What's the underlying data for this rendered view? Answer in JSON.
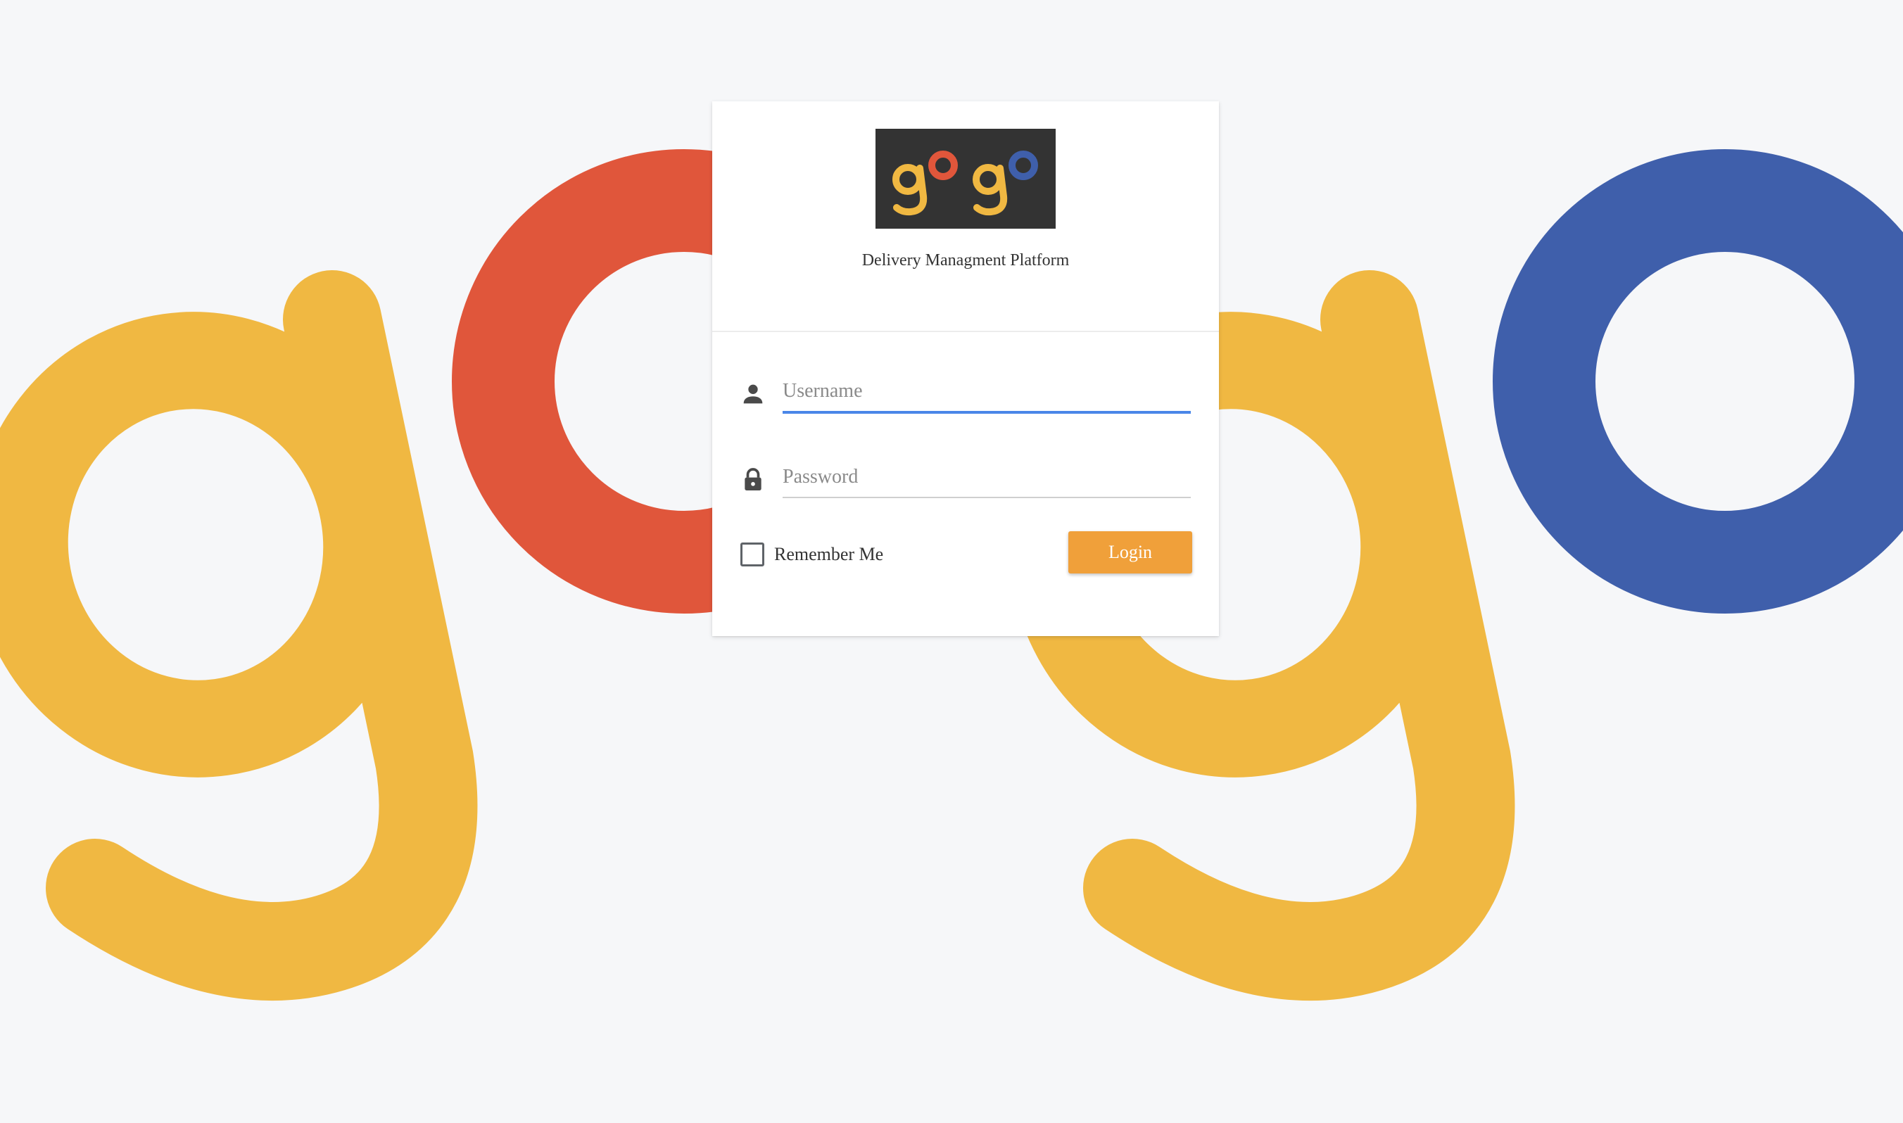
{
  "app": {
    "title": "Delivery Managment Platform"
  },
  "colors": {
    "background": "#f6f7f9",
    "brand_yellow": "#f0b842",
    "brand_red": "#e0563b",
    "brand_blue": "#3f5fab",
    "accent_orange": "#f0a03a",
    "focus_blue": "#4a86e8",
    "logo_box": "#333333"
  },
  "logo": {
    "icon": "gogo-logo"
  },
  "form": {
    "username": {
      "placeholder": "Username",
      "value": "",
      "icon": "person-icon"
    },
    "password": {
      "placeholder": "Password",
      "value": "",
      "icon": "lock-icon"
    },
    "remember_label": "Remember Me",
    "remember_checked": false,
    "login_label": "Login"
  }
}
